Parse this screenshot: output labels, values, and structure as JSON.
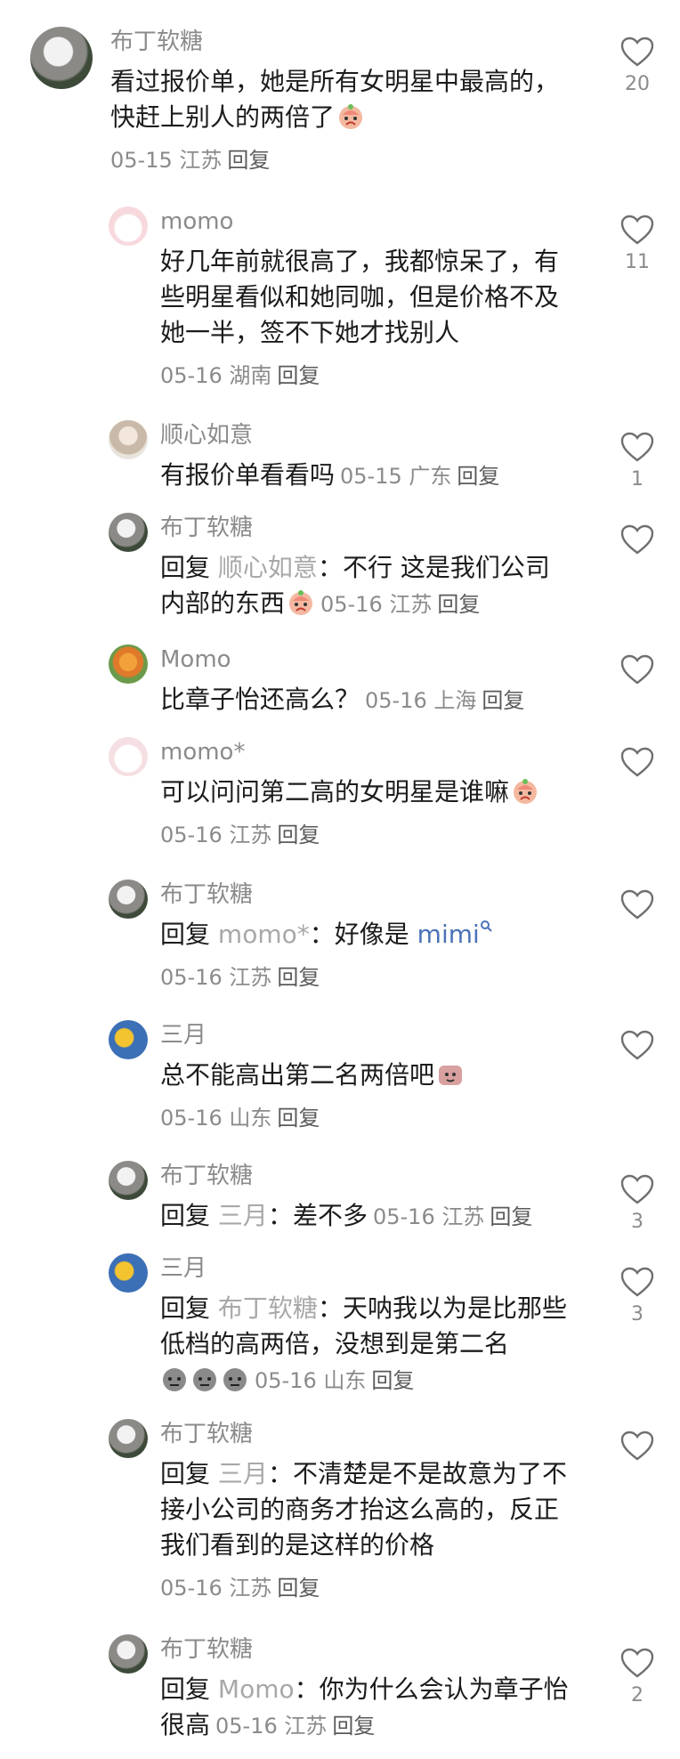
{
  "comments": [
    {
      "user": "布丁软糖",
      "text_parts": [
        "看过报价单，她是所有女明星中最高的，快赶上别人的两倍了"
      ],
      "meta_date": "05-15",
      "meta_loc": "江苏",
      "reply_label": "回复",
      "likes": "20"
    },
    {
      "user": "momo",
      "text_parts": [
        "好几年前就很高了，我都惊呆了，有些明星看似和她同咖，但是价格不及她一半，签不下她才找别人"
      ],
      "meta_date": "05-16",
      "meta_loc": "湖南",
      "reply_label": "回复",
      "likes": "11"
    },
    {
      "user": "顺心如意",
      "text_parts": [
        "有报价单看看吗"
      ],
      "meta_date": "05-15",
      "meta_loc": "广东",
      "reply_label": "回复",
      "likes": "1"
    },
    {
      "user": "布丁软糖",
      "reply_prefix": "回复",
      "reply_to": "顺心如意",
      "colon": "：",
      "text_parts": [
        "不行 这是我们公司内部的东西"
      ],
      "meta_date": "05-16",
      "meta_loc": "江苏",
      "reply_label": "回复",
      "likes": ""
    },
    {
      "user": "Momo",
      "text_parts": [
        "比章子怡还高么？"
      ],
      "meta_date": "05-16",
      "meta_loc": "上海",
      "reply_label": "回复",
      "likes": ""
    },
    {
      "user": "momo*",
      "text_parts": [
        "可以问问第二高的女明星是谁嘛"
      ],
      "meta_date": "05-16",
      "meta_loc": "江苏",
      "reply_label": "回复",
      "likes": ""
    },
    {
      "user": "布丁软糖",
      "reply_prefix": "回复",
      "reply_to": "momo*",
      "colon": "：",
      "text_parts": [
        "好像是"
      ],
      "link": "mimi",
      "meta_date": "05-16",
      "meta_loc": "江苏",
      "reply_label": "回复",
      "likes": ""
    },
    {
      "user": "三月",
      "text_parts": [
        "总不能高出第二名两倍吧"
      ],
      "meta_date": "05-16",
      "meta_loc": "山东",
      "reply_label": "回复",
      "likes": ""
    },
    {
      "user": "布丁软糖",
      "reply_prefix": "回复",
      "reply_to": "三月",
      "colon": "：",
      "text_parts": [
        "差不多"
      ],
      "meta_date": "05-16",
      "meta_loc": "江苏",
      "reply_label": "回复",
      "likes": "3"
    },
    {
      "user": "三月",
      "reply_prefix": "回复",
      "reply_to": "布丁软糖",
      "colon": "：",
      "text_parts": [
        "天呐我以为是比那些低档的高两倍，没想到是第二名"
      ],
      "meta_date": "05-16",
      "meta_loc": "山东",
      "reply_label": "回复",
      "likes": "3"
    },
    {
      "user": "布丁软糖",
      "reply_prefix": "回复",
      "reply_to": "三月",
      "colon": "：",
      "text_parts": [
        "不清楚是不是故意为了不接小公司的商务才抬这么高的，反正我们看到的是这样的价格"
      ],
      "meta_date": "05-16",
      "meta_loc": "江苏",
      "reply_label": "回复",
      "likes": ""
    },
    {
      "user": "布丁软糖",
      "reply_prefix": "回复",
      "reply_to": "Momo",
      "colon": "：",
      "text_parts": [
        "你为什么会认为章子怡很高"
      ],
      "meta_date": "05-16",
      "meta_loc": "江苏",
      "reply_label": "回复",
      "likes": "2"
    }
  ],
  "icons": {
    "like": "heart-outline-icon",
    "search": "search-icon"
  },
  "colors": {
    "username": "#8b8b8b",
    "text": "#1c1c1c",
    "link": "#4a72b8",
    "mention": "#a8a8a8"
  }
}
